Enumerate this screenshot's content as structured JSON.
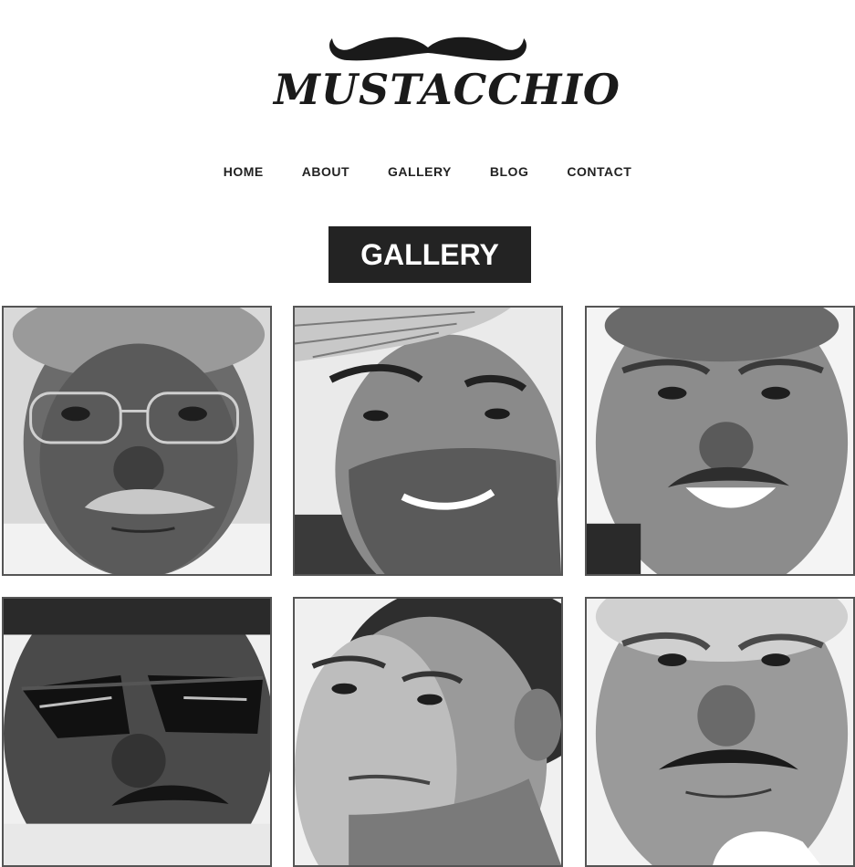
{
  "brand": {
    "name": "MUSTACCHIO",
    "logo_icon": "mustache-icon"
  },
  "nav": {
    "items": [
      {
        "label": "HOME"
      },
      {
        "label": "ABOUT"
      },
      {
        "label": "GALLERY"
      },
      {
        "label": "BLOG"
      },
      {
        "label": "CONTACT"
      }
    ]
  },
  "page": {
    "title": "GALLERY"
  },
  "gallery": {
    "photos": [
      {
        "subject": "older man with glasses and grey mustache"
      },
      {
        "subject": "smiling young man in straw hat with beard"
      },
      {
        "subject": "older man with mustache smiling broadly"
      },
      {
        "subject": "man in sunglasses with dark mustache"
      },
      {
        "subject": "young man with curly hair and stubble"
      },
      {
        "subject": "grey-haired man with dark mustache"
      }
    ]
  },
  "colors": {
    "title_bg": "#232323",
    "title_text": "#ffffff",
    "nav_text": "#222222",
    "photo_border": "#555555"
  }
}
